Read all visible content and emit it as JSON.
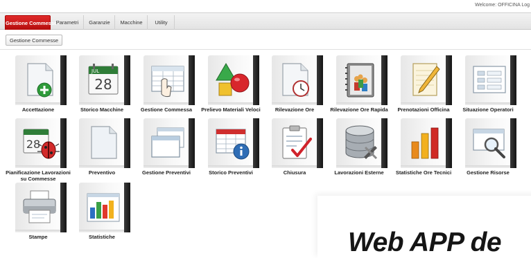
{
  "header": {
    "welcome": "Welcome: OFFICINA   Log"
  },
  "tabs": [
    {
      "label": "Gestione Commesse",
      "active": true
    },
    {
      "label": "Parametri",
      "active": false
    },
    {
      "label": "Garanzie",
      "active": false
    },
    {
      "label": "Macchine",
      "active": false
    },
    {
      "label": "Utility",
      "active": false
    }
  ],
  "breadcrumb": "Gestione Commesse",
  "tiles": [
    {
      "label": "Accettazione",
      "icon": "document-add-icon"
    },
    {
      "label": "Storico Macchine",
      "icon": "calendar-icon",
      "calendar_month": "JUL",
      "calendar_day": "28"
    },
    {
      "label": "Gestione Commessa",
      "icon": "hand-table-icon"
    },
    {
      "label": "Prelievo Materiali Veloci",
      "icon": "shapes-icon"
    },
    {
      "label": "Rilevazione Ore",
      "icon": "document-clock-icon"
    },
    {
      "label": "Rilevazione Ore Rapida",
      "icon": "agenda-people-icon"
    },
    {
      "label": "Prenotazioni Officina",
      "icon": "notepad-pencil-icon"
    },
    {
      "label": "Situazione Operatori",
      "icon": "form-grid-icon"
    },
    {
      "label": "Pianificazione Lavorazioni su Commesse",
      "icon": "calendar-bug-icon",
      "calendar_day": "28"
    },
    {
      "label": "Preventivo",
      "icon": "blank-document-icon"
    },
    {
      "label": "Gestione Preventivi",
      "icon": "windows-stack-icon"
    },
    {
      "label": "Storico Preventivi",
      "icon": "table-info-icon"
    },
    {
      "label": "Chiusura",
      "icon": "clipboard-check-icon"
    },
    {
      "label": "Lavorazioni Esterne",
      "icon": "database-tools-icon"
    },
    {
      "label": "Statistiche Ore Tecnici",
      "icon": "bar-chart-icon"
    },
    {
      "label": "Gestione Risorse",
      "icon": "window-magnifier-icon"
    },
    {
      "label": "Stampe",
      "icon": "printer-icon"
    },
    {
      "label": "Statistiche",
      "icon": "colored-bars-icon"
    }
  ],
  "watermark": "Web APP de",
  "colors": {
    "accent": "#c8161d",
    "tab_bar": "#e8e8e8",
    "text": "#222222"
  }
}
